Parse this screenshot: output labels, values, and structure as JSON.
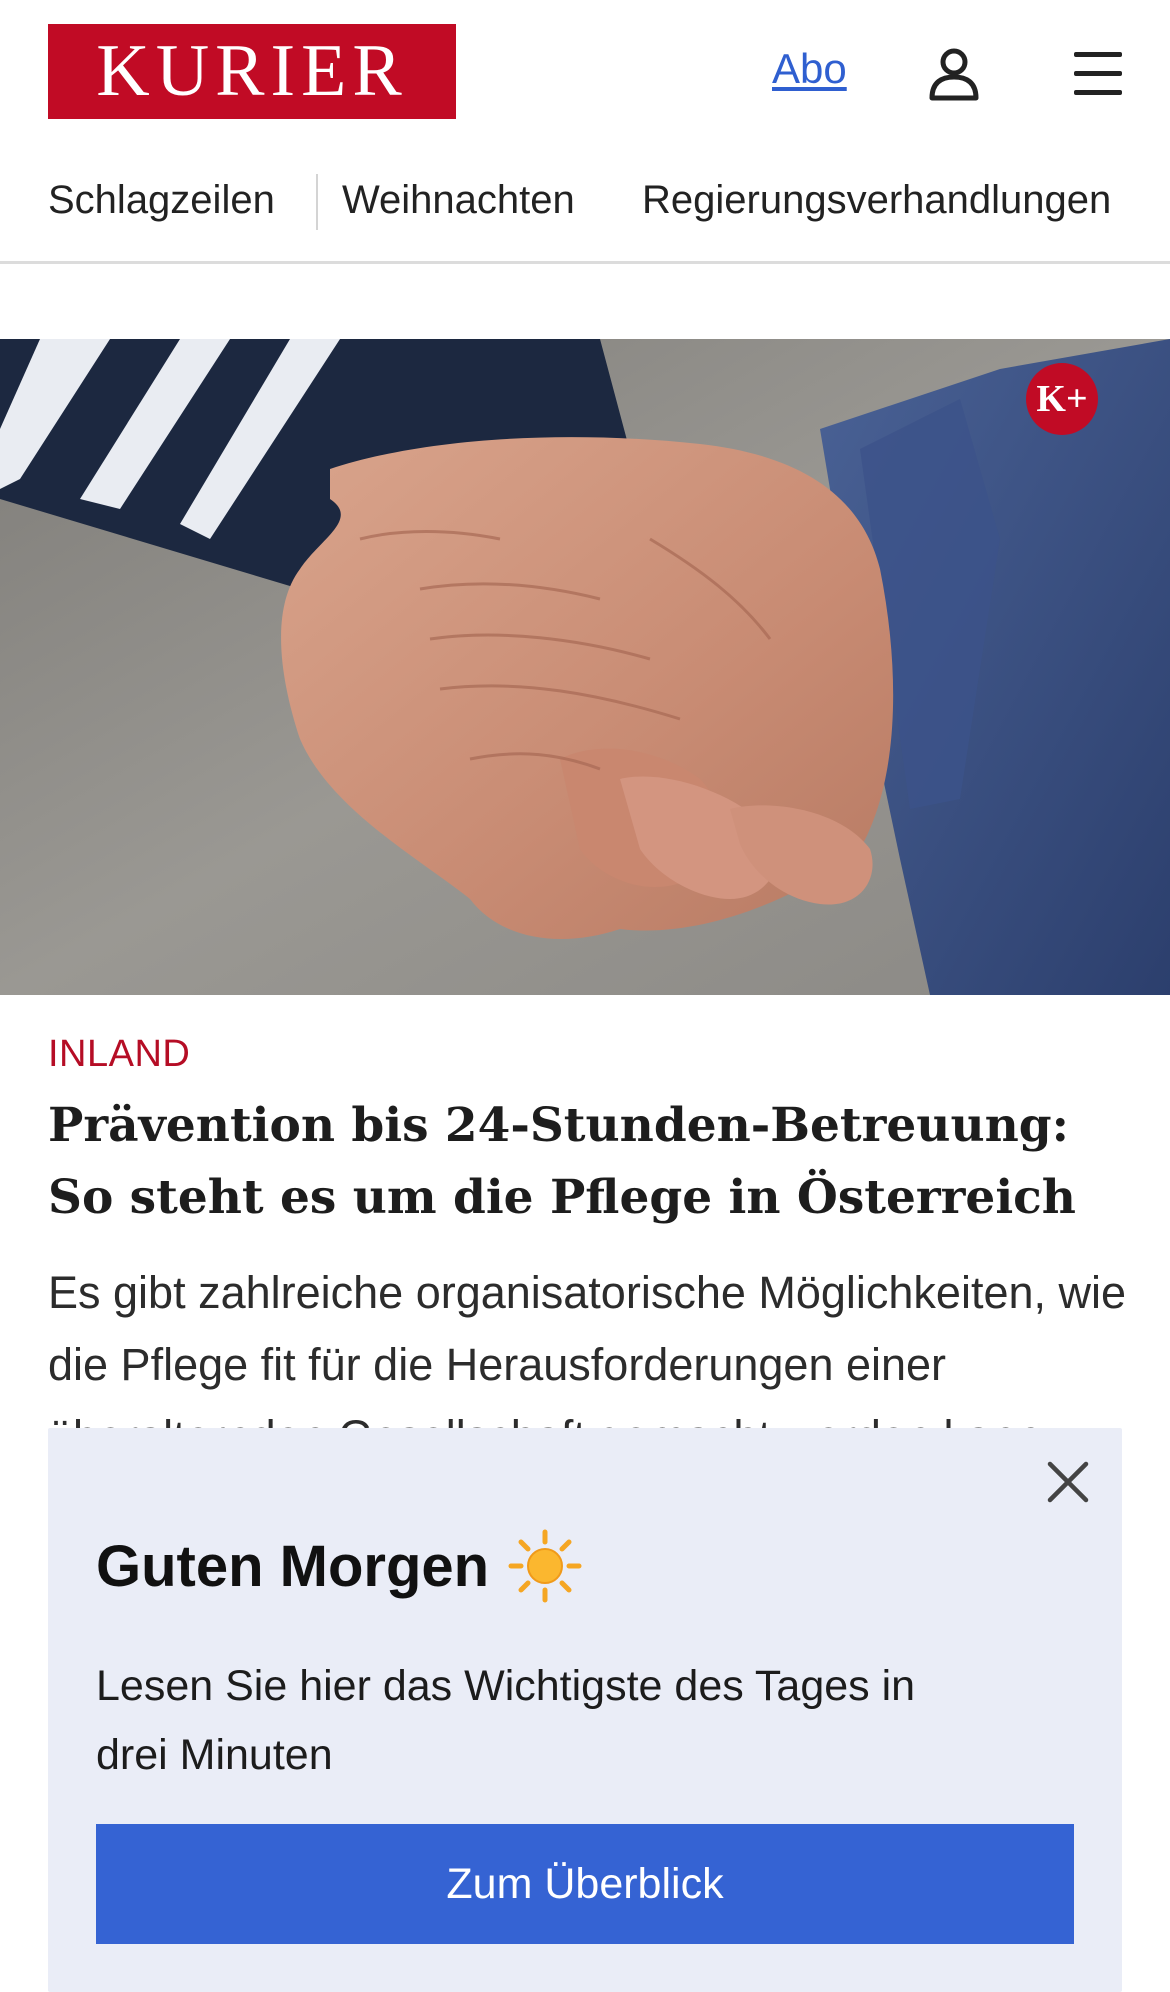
{
  "header": {
    "logo_text": "KURIER",
    "abo_label": "Abo",
    "user_icon": "user-icon",
    "menu_icon": "hamburger-menu-icon",
    "brand_color": "#c10b25"
  },
  "nav": {
    "items": [
      {
        "label": "Schlagzeilen"
      },
      {
        "label": "Weihnachten"
      },
      {
        "label": "Regierungsverhandlungen"
      }
    ]
  },
  "article": {
    "badge_text": "K+",
    "rubric": "INLAND",
    "headline": "Prävention bis 24-Stunden-Betreuung: So steht es um die Pflege in Österreich",
    "lead": "Es gibt zahlreiche organisatorische Möglichkeiten, wie die Pflege fit für die Herausforderungen einer überalternden Gesellschaft gemacht werden kann."
  },
  "popup": {
    "title": "Guten Morgen",
    "title_icon": "sun-icon",
    "text": "Lesen Sie hier das Wichtigste des Tages in drei Minuten",
    "button_label": "Zum Überblick",
    "close_icon": "close-icon",
    "accent_color": "#3563d3"
  }
}
